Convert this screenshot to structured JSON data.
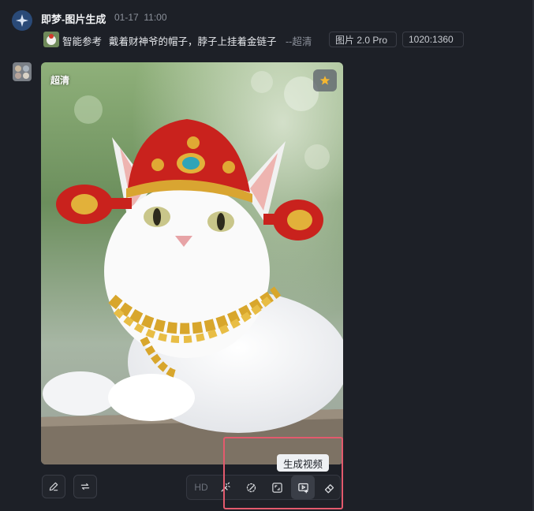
{
  "header": {
    "app_name": "即梦-图片生成",
    "date": "01-17",
    "time": "11:00"
  },
  "prompt": {
    "reference_label": "智能参考",
    "text": "戴着财神爷的帽子，脖子上挂着金链子",
    "quality_suffix": "--超清",
    "model_tag": "图片 2.0 Pro",
    "size_tag": "1020:1360"
  },
  "image": {
    "quality_badge": "超清",
    "starred": true
  },
  "actions": {
    "hd_label": "HD",
    "tooltip": "生成视频"
  },
  "icons": {
    "app": "spark-icon",
    "star": "star-icon",
    "edit": "pencil-icon",
    "regenerate": "repeat-icon",
    "retouch": "magic-pen-icon",
    "inpaint": "lasso-brush-icon",
    "expand": "expand-frame-icon",
    "video": "video-generate-icon",
    "erase": "eraser-icon"
  },
  "colors": {
    "background": "#1d2027",
    "highlight": "#e35a6d",
    "star": "#f5b731"
  }
}
